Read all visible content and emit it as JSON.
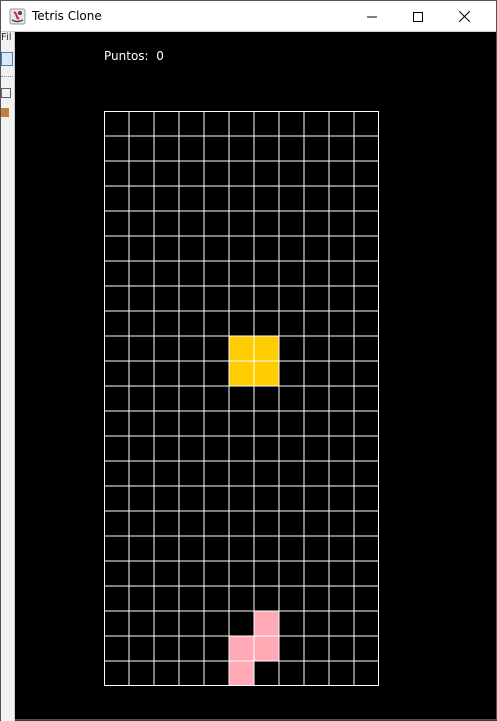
{
  "window": {
    "title": "Tetris Clone",
    "icon": "java-app-icon",
    "controls": [
      "minimize-icon",
      "maximize-icon",
      "close-icon"
    ]
  },
  "left_strip_text": "Fil",
  "score": {
    "label": "Puntos:",
    "value": "0"
  },
  "board": {
    "columns": 11,
    "rows": 23,
    "background": "#000000",
    "grid_color": "#ffffff",
    "pieces": [
      {
        "name": "falling-o-piece",
        "color": "#FFCC00",
        "cells": [
          [
            5,
            9
          ],
          [
            6,
            9
          ],
          [
            5,
            10
          ],
          [
            6,
            10
          ]
        ]
      },
      {
        "name": "landed-s-piece",
        "color": "#FFAAB4",
        "cells": [
          [
            6,
            20
          ],
          [
            5,
            21
          ],
          [
            6,
            21
          ],
          [
            5,
            22
          ]
        ]
      }
    ]
  }
}
